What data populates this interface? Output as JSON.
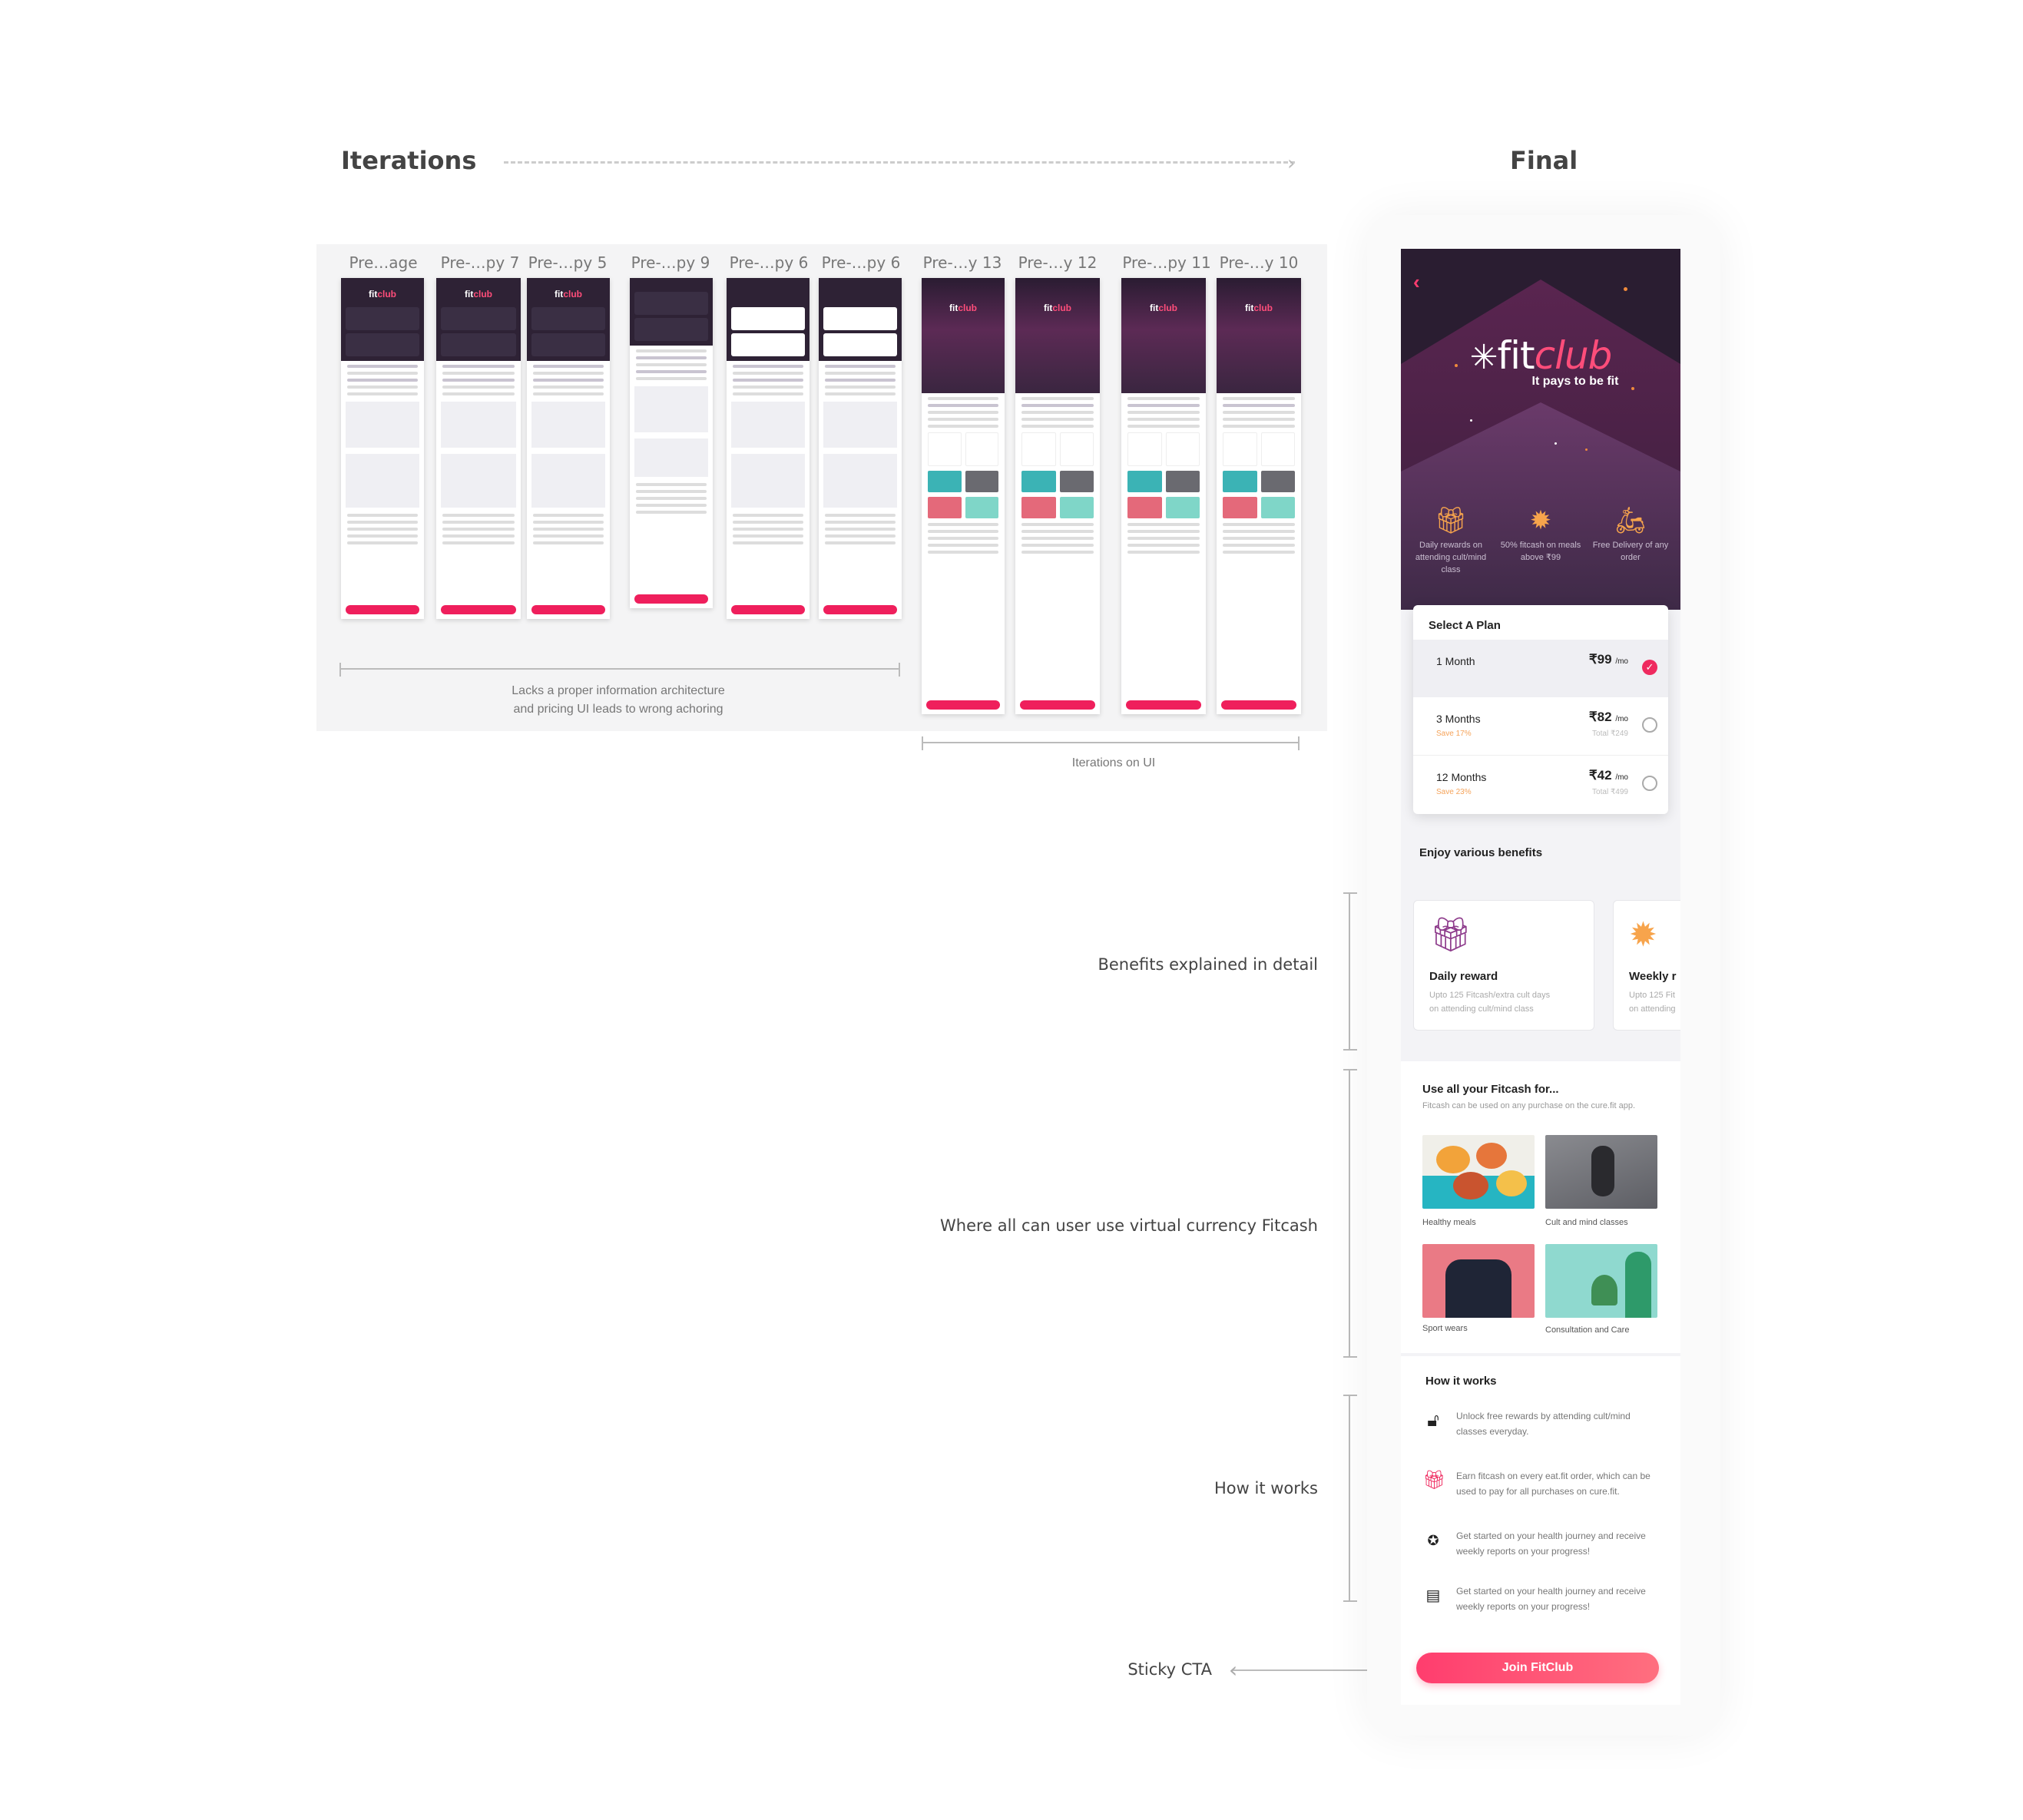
{
  "headings": {
    "iterations": "Iterations",
    "final": "Final"
  },
  "thumb_labels": [
    "Pre…age",
    "Pre-…py 7",
    "Pre-…py 5",
    "Pre-…py 9",
    "Pre-…py 6",
    "Pre-…py 6",
    "Pre-…y 13",
    "Pre-…y 12",
    "Pre-…py 11",
    "Pre-…y 10"
  ],
  "captions": {
    "ia": "Lacks a proper information architecture",
    "ia2": "and pricing UI leads to wrong achoring",
    "ui": "Iterations on UI"
  },
  "side_labels": {
    "benefits": "Benefits explained in detail",
    "fitcash": "Where all can user use virtual currency Fitcash",
    "how": "How it works",
    "cta": "Sticky CTA"
  },
  "app": {
    "brand_fit": "fit",
    "brand_club": "club",
    "tagline": "It pays to be fit",
    "features": [
      {
        "icon": "gift-icon",
        "text": "Daily rewards on attending cult/mind class"
      },
      {
        "icon": "badge-icon",
        "text": "50% fitcash on meals above ₹99"
      },
      {
        "icon": "scooter-icon",
        "text": "Free Delivery of any order"
      }
    ],
    "plan_title": "Select A Plan",
    "plans": [
      {
        "name": "1 Month",
        "price": "₹99",
        "unit": "/mo",
        "save": "",
        "total": "",
        "selected": true
      },
      {
        "name": "3 Months",
        "price": "₹82",
        "unit": "/mo",
        "save": "Save 17%",
        "total": "Total ₹249",
        "selected": false
      },
      {
        "name": "12 Months",
        "price": "₹42",
        "unit": "/mo",
        "save": "Save 23%",
        "total": "Total ₹499",
        "selected": false
      }
    ],
    "benefits_title": "Enjoy various benefits",
    "benefit_cards": [
      {
        "title": "Daily reward",
        "desc1": "Upto 125 Fitcash/extra cult days",
        "desc2": "on attending cult/mind class"
      },
      {
        "title": "Weekly r",
        "desc1": "Upto 125 Fit",
        "desc2": "on attending"
      }
    ],
    "fitcash_title": "Use all your Fitcash for...",
    "fitcash_sub": "Fitcash can be used on any purchase on the cure.fit app.",
    "fitcash_tiles": [
      "Healthy meals",
      "Cult and mind  classes",
      "Sport wears",
      "Consultation and Care"
    ],
    "how_title": "How it works",
    "how_items": [
      "Unlock free rewards by attending cult/mind classes everyday.",
      "Earn fitcash on every eat.fit order, which can be used to pay for all purchases on cure.fit.",
      "Get started on your health journey and receive weekly reports on your progress!",
      "Get started on your health journey and receive weekly reports on your progress!"
    ],
    "cta": "Join FitClub"
  },
  "colors": {
    "accent": "#ef2a5f",
    "header_bg": "#2a1d31",
    "save": "#f5a35a"
  }
}
